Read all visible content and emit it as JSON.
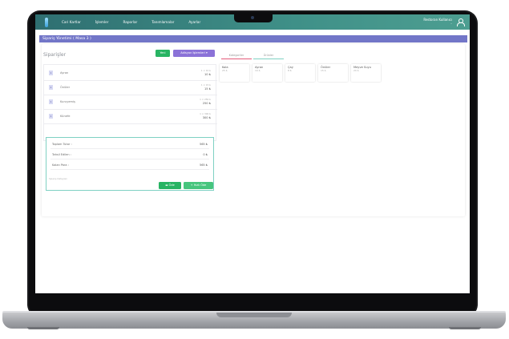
{
  "nav": {
    "items": [
      "Cari Kartlar",
      "İşlemler",
      "Raporlar",
      "Tanımlamalar",
      "Ayarlar"
    ]
  },
  "user": {
    "name": "Restoran Kullanıcı",
    "sub": "--"
  },
  "page": {
    "title": "Sipariş Yönetimi ( Masa 3 )"
  },
  "orders": {
    "title": "Siparişler",
    "new_label": "Yeni",
    "table_ops_label": "Adisyon İşlemleri  ▾",
    "items": [
      {
        "qty": "1",
        "name": "Ayran",
        "unit": "1 × 10 ₺",
        "total": "10 ₺"
      },
      {
        "qty": "1",
        "name": "Önüler",
        "unit": "1 × 15 ₺",
        "total": "15 ₺"
      },
      {
        "qty": "1",
        "name": "Kuruyemiş",
        "unit": "1 × 250 ₺",
        "total": "250 ₺"
      },
      {
        "qty": "1",
        "name": "Künefe",
        "unit": "1 × 300 ₺",
        "total": "300 ₺"
      }
    ]
  },
  "summary": {
    "rows": [
      {
        "label": "Toplam Tutar :",
        "value": "565 ₺"
      },
      {
        "label": "Tahsil Edilen :",
        "value": "0 ₺"
      },
      {
        "label": "Kalan Para :",
        "value": "565 ₺"
      }
    ],
    "note": "Sipariş Detayları",
    "pay_label": "Öde",
    "quick_pay_label": "Hızlı Öde"
  },
  "tabs": [
    "Kategoriler",
    "Ürünler"
  ],
  "products": [
    {
      "name": "Kola",
      "price": "25 ₺"
    },
    {
      "name": "Ayran",
      "price": "10 ₺"
    },
    {
      "name": "Çay",
      "price": "8 ₺"
    },
    {
      "name": "Önüler",
      "price": "15 ₺"
    },
    {
      "name": "Meyve Suyu",
      "price": "20 ₺"
    }
  ]
}
